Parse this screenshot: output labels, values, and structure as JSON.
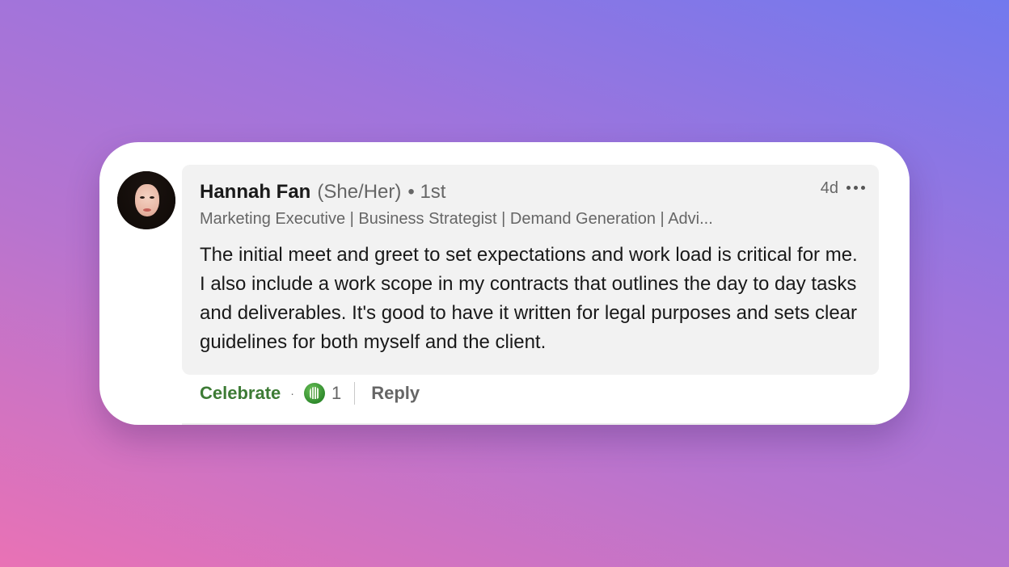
{
  "comment": {
    "author": {
      "name": "Hannah Fan",
      "pronouns": "(She/Her)",
      "degree": "• 1st",
      "headline": "Marketing Executive | Business Strategist | Demand Generation | Advi..."
    },
    "timestamp": "4d",
    "body": "The initial meet and greet to set expectations and work load is critical for me. I also include a work scope in my contracts that outlines the day to day tasks and deliverables. It's good to have it written for legal purposes and sets clear guidelines for both myself and the client.",
    "actions": {
      "reaction_label": "Celebrate",
      "separator": "·",
      "reaction_count": "1",
      "reply_label": "Reply"
    }
  },
  "icons": {
    "more": "more-horizontal-icon",
    "reaction": "celebrate-reaction-icon"
  },
  "colors": {
    "celebrate": "#3d7b35",
    "bubble": "#f2f2f2",
    "text_primary": "#191919",
    "text_secondary": "#666666"
  }
}
